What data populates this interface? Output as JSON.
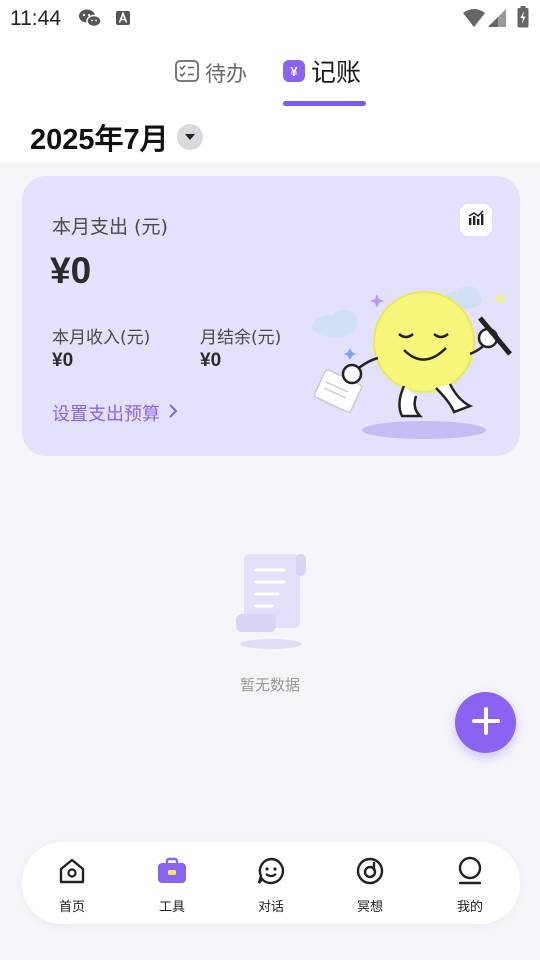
{
  "status_bar": {
    "time": "11:44",
    "icons": [
      "wechat-icon",
      "a-icon",
      "wifi-icon",
      "signal-icon",
      "battery-icon"
    ]
  },
  "header": {
    "tabs": [
      {
        "label": "待办",
        "icon": "todo-list-icon",
        "active": false
      },
      {
        "label": "记账",
        "icon": "yen-badge-icon",
        "active": true
      }
    ],
    "month_label": "2025年7月",
    "yen_badge": "¥"
  },
  "summary_card": {
    "expense_label": "本月支出 (元)",
    "expense_value": "¥0",
    "income_label": "本月收入(元)",
    "income_value": "¥0",
    "balance_label": "月结余(元)",
    "balance_value": "¥0",
    "budget_link": "设置支出预算",
    "chart_button_icon": "stats-chart-icon"
  },
  "empty_state": {
    "text": "暂无数据",
    "icon": "empty-scroll-icon"
  },
  "fab": {
    "icon": "plus-icon"
  },
  "bottom_nav": {
    "items": [
      {
        "label": "首页",
        "icon": "home-icon",
        "active": false
      },
      {
        "label": "工具",
        "icon": "toolbox-icon",
        "active": true
      },
      {
        "label": "对话",
        "icon": "chat-smile-icon",
        "active": false
      },
      {
        "label": "冥想",
        "icon": "meditation-icon",
        "active": false
      },
      {
        "label": "我的",
        "icon": "profile-icon",
        "active": false
      }
    ]
  },
  "colors": {
    "accent": "#8b63f2",
    "card_bg": "#e3e1fb",
    "page_bg": "#f4f5f9"
  }
}
